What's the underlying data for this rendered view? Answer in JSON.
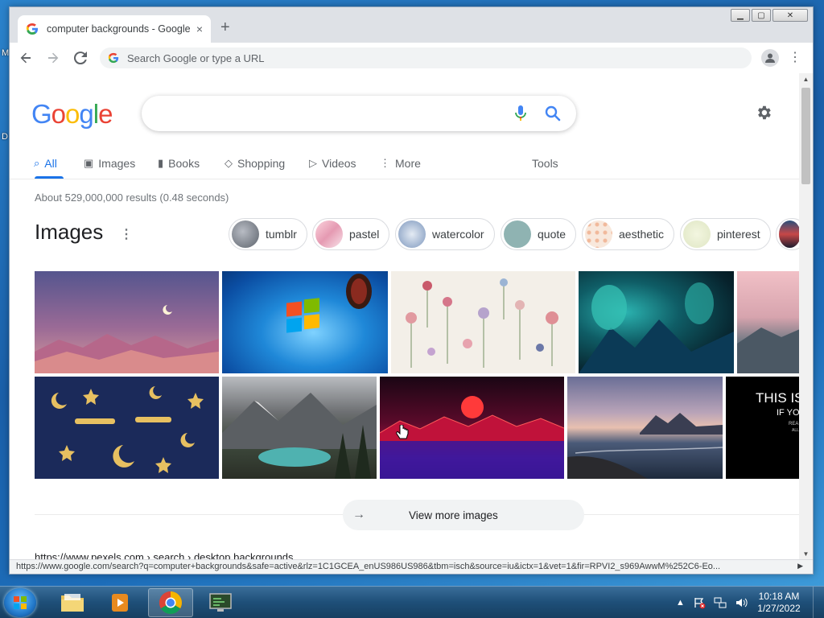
{
  "desktop": {
    "label_1": "M",
    "label_2": "D"
  },
  "browser": {
    "tab_title": "computer backgrounds - Google Search",
    "tab_close": "×",
    "new_tab": "+",
    "window_buttons": {
      "minimize": "▁",
      "maximize": "▢",
      "close": "✕"
    },
    "omnibox_placeholder": "Search Google or type a URL",
    "menu": "⋮",
    "status_url": "https://www.google.com/search?q=computer+backgrounds&safe=active&rlz=1C1GCEA_enUS986US986&tbm=isch&source=iu&ictx=1&vet=1&fir=RPVI2_s969AwwM%252C6-Eo..."
  },
  "google": {
    "logo": [
      "G",
      "o",
      "o",
      "g",
      "l",
      "e"
    ],
    "logo_colors": [
      "#4285f4",
      "#ea4335",
      "#fbbc05",
      "#4285f4",
      "#34a853",
      "#ea4335"
    ],
    "search_value": "",
    "apps": "⋮"
  },
  "tabs": [
    {
      "label": "All",
      "icon": "⌕"
    },
    {
      "label": "Images",
      "icon": "▣"
    },
    {
      "label": "Books",
      "icon": "▮"
    },
    {
      "label": "Shopping",
      "icon": "◇"
    },
    {
      "label": "Videos",
      "icon": "▷"
    },
    {
      "label": "More",
      "icon": "⋮"
    }
  ],
  "tools": "Tools",
  "result_stats": "About 529,000,000 results (0.48 seconds)",
  "images_section": {
    "heading": "Images",
    "more": "⋮"
  },
  "chips": [
    {
      "label": "tumblr",
      "color": "#8a9099"
    },
    {
      "label": "pastel",
      "color": "#f2b8c6"
    },
    {
      "label": "watercolor",
      "color": "#9fb4cf"
    },
    {
      "label": "quote",
      "color": "#8fb3b2"
    },
    {
      "label": "aesthetic",
      "color": "#f6d9c4"
    },
    {
      "label": "pinterest",
      "color": "#eef2d8"
    }
  ],
  "view_more": "View more images",
  "next_result": "https://www.pexels.com › search › desktop backgrounds",
  "taskbar": {
    "time": "10:18 AM",
    "date": "1/27/2022",
    "tray_arrow": "▲"
  }
}
